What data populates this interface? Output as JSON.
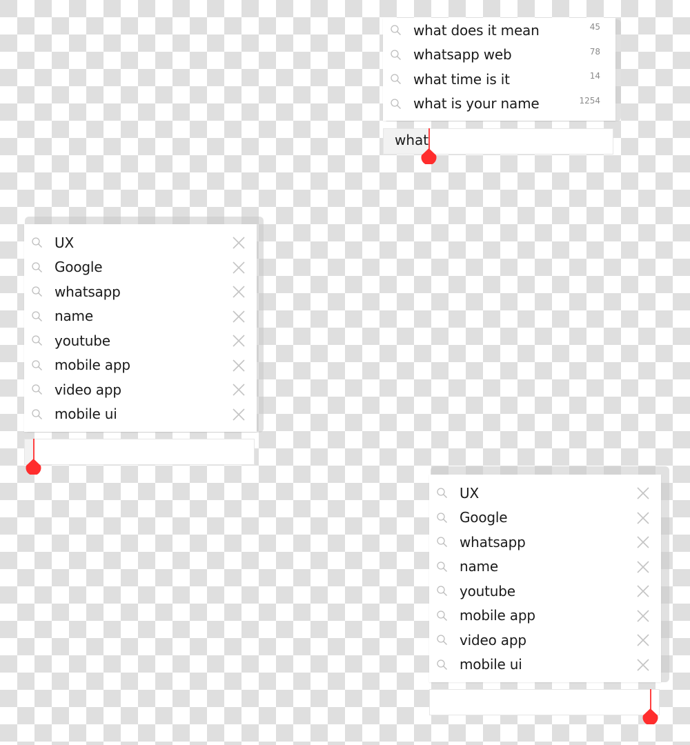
{
  "colors": {
    "accent": "#ff2d2d",
    "text": "#1a1a1a",
    "muted": "#8a8a8a",
    "icon": "#bdbdbd"
  },
  "autocomplete_panel": {
    "input_value": "what",
    "suggestions": [
      {
        "label": "what does it mean",
        "count": "45",
        "icon": "search-icon"
      },
      {
        "label": "whatsapp web",
        "count": "78",
        "icon": "search-icon"
      },
      {
        "label": "what time is it",
        "count": "14",
        "icon": "search-icon"
      },
      {
        "label": "what is your name",
        "count": "1254",
        "icon": "search-icon"
      }
    ]
  },
  "history_panel_left": {
    "input_value": "",
    "items": [
      {
        "label": "UX",
        "icon": "search-icon",
        "action": "close-icon"
      },
      {
        "label": "Google",
        "icon": "search-icon",
        "action": "close-icon"
      },
      {
        "label": "whatsapp",
        "icon": "search-icon",
        "action": "close-icon"
      },
      {
        "label": "name",
        "icon": "search-icon",
        "action": "close-icon"
      },
      {
        "label": "youtube",
        "icon": "search-icon",
        "action": "close-icon"
      },
      {
        "label": "mobile app",
        "icon": "search-icon",
        "action": "close-icon"
      },
      {
        "label": "video app",
        "icon": "search-icon",
        "action": "close-icon"
      },
      {
        "label": "mobile ui",
        "icon": "search-icon",
        "action": "close-icon"
      }
    ]
  },
  "history_panel_right": {
    "input_value": "",
    "items": [
      {
        "label": "UX",
        "icon": "search-icon",
        "action": "close-icon"
      },
      {
        "label": "Google",
        "icon": "search-icon",
        "action": "close-icon"
      },
      {
        "label": "whatsapp",
        "icon": "search-icon",
        "action": "close-icon"
      },
      {
        "label": "name",
        "icon": "search-icon",
        "action": "close-icon"
      },
      {
        "label": "youtube",
        "icon": "search-icon",
        "action": "close-icon"
      },
      {
        "label": "mobile app",
        "icon": "search-icon",
        "action": "close-icon"
      },
      {
        "label": "video app",
        "icon": "search-icon",
        "action": "close-icon"
      },
      {
        "label": "mobile ui",
        "icon": "search-icon",
        "action": "close-icon"
      }
    ]
  }
}
